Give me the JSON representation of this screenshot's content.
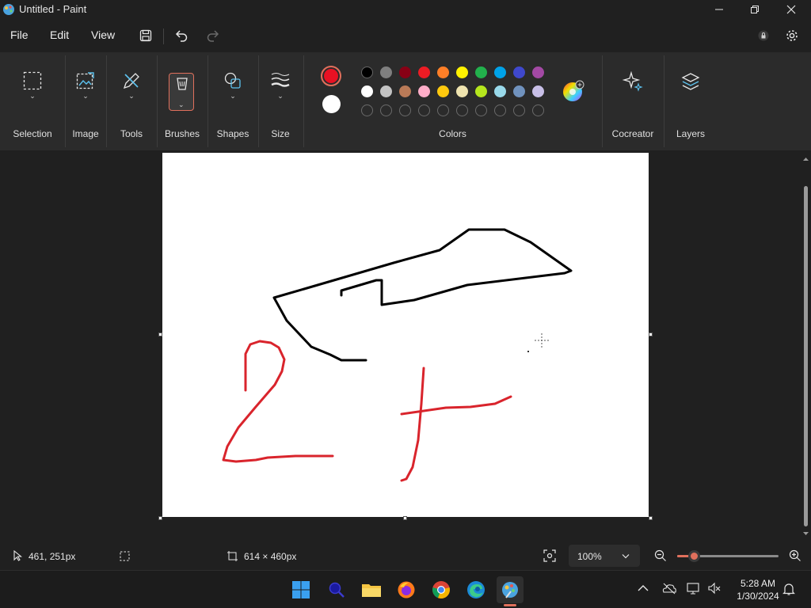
{
  "window": {
    "title": "Untitled - Paint"
  },
  "menu": {
    "file": "File",
    "edit": "Edit",
    "view": "View"
  },
  "ribbon": {
    "groups": {
      "selection": "Selection",
      "image": "Image",
      "tools": "Tools",
      "brushes": "Brushes",
      "shapes": "Shapes",
      "size": "Size",
      "colors": "Colors",
      "cocreator": "Cocreator",
      "layers": "Layers"
    },
    "primary_color": "#e81123",
    "secondary_color": "#ffffff",
    "palette_row1": [
      "#000000",
      "#7f7f7f",
      "#880015",
      "#ed1c24",
      "#ff7f27",
      "#fff200",
      "#22b14c",
      "#00a2e8",
      "#3f48cc",
      "#a349a4"
    ],
    "palette_row2": [
      "#ffffff",
      "#c3c3c3",
      "#b97a57",
      "#ffaec9",
      "#ffc90e",
      "#efe4b0",
      "#b5e61d",
      "#99d9ea",
      "#7092be",
      "#c8bfe7"
    ],
    "custom_slots": 10
  },
  "status": {
    "cursor_position": "461, 251px",
    "canvas_size": "614 × 460px",
    "zoom": "100%"
  },
  "taskbar": {
    "time": "5:28 AM",
    "date": "1/30/2024"
  },
  "accent_color": "#e0705c"
}
